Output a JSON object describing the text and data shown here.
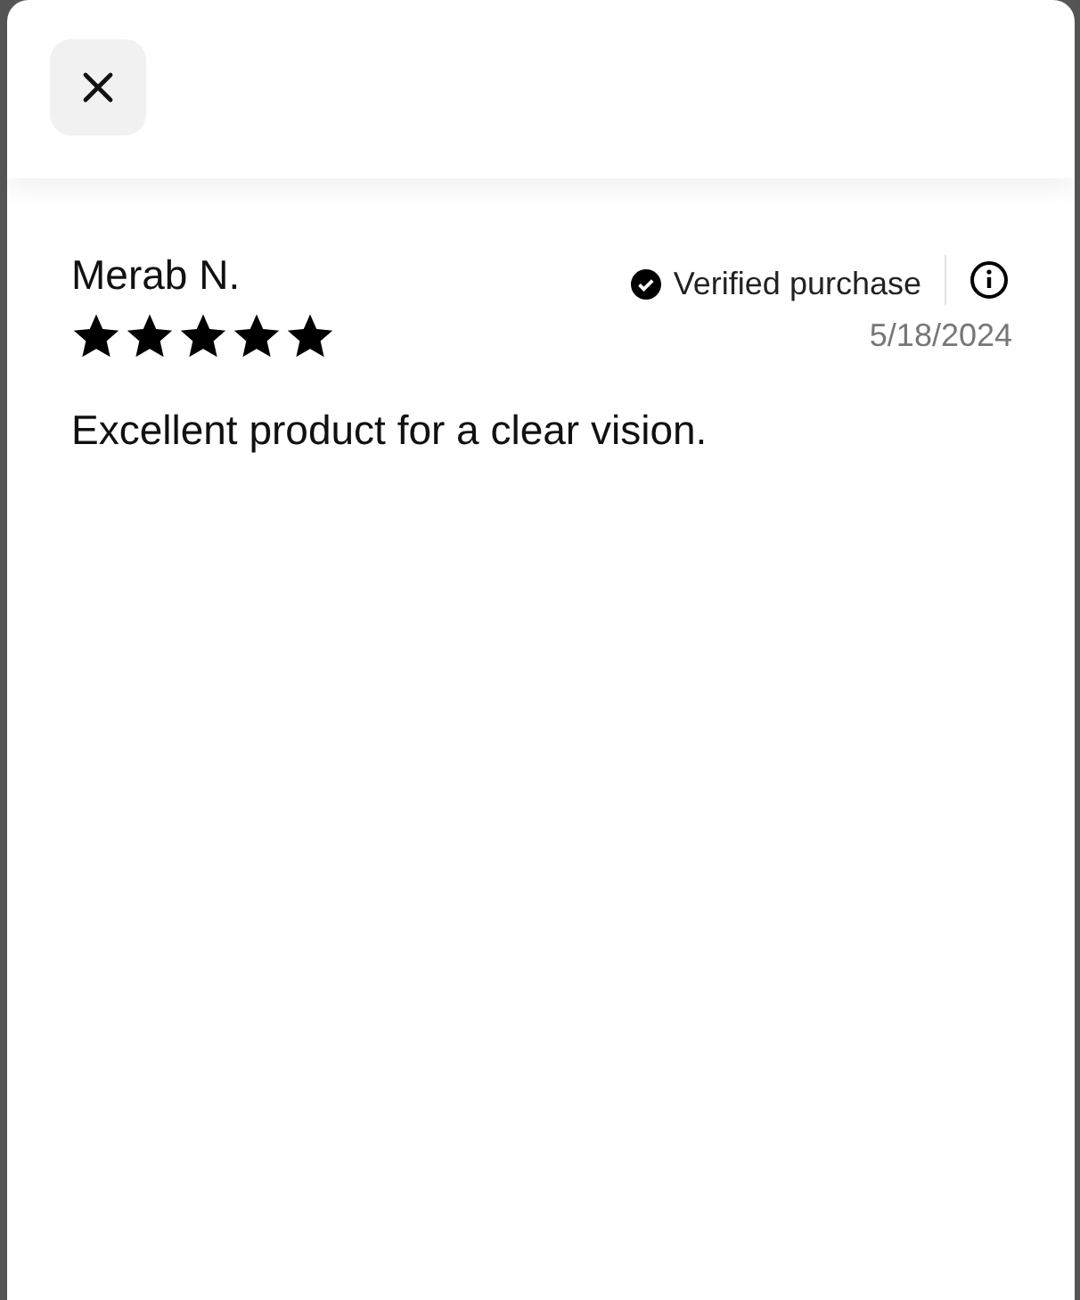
{
  "review": {
    "author": "Merab N.",
    "verified": true,
    "verified_label": "Verified purchase",
    "stars": 5,
    "date": "5/18/2024",
    "text": "Excellent product for a clear vision."
  }
}
